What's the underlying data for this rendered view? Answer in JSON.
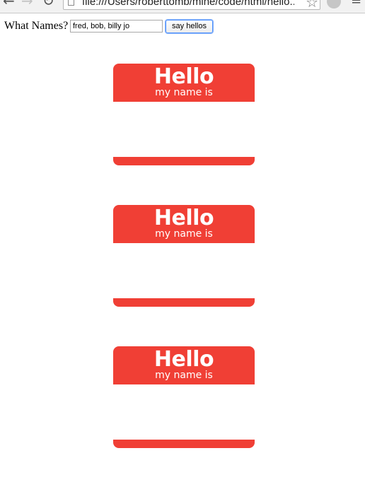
{
  "browser": {
    "url": "file:///Users/roberttomb/mine/code/html/hello..."
  },
  "form": {
    "label": "What Names?",
    "input_value": "fred, bob, billy jo",
    "button_label": "say hellos"
  },
  "name_tags": [
    {
      "hello": "Hello",
      "subtitle": "my name is"
    },
    {
      "hello": "Hello",
      "subtitle": "my name is"
    },
    {
      "hello": "Hello",
      "subtitle": "my name is"
    }
  ],
  "colors": {
    "tag_red": "#f03f35",
    "button_focus": "#4d90fe"
  }
}
